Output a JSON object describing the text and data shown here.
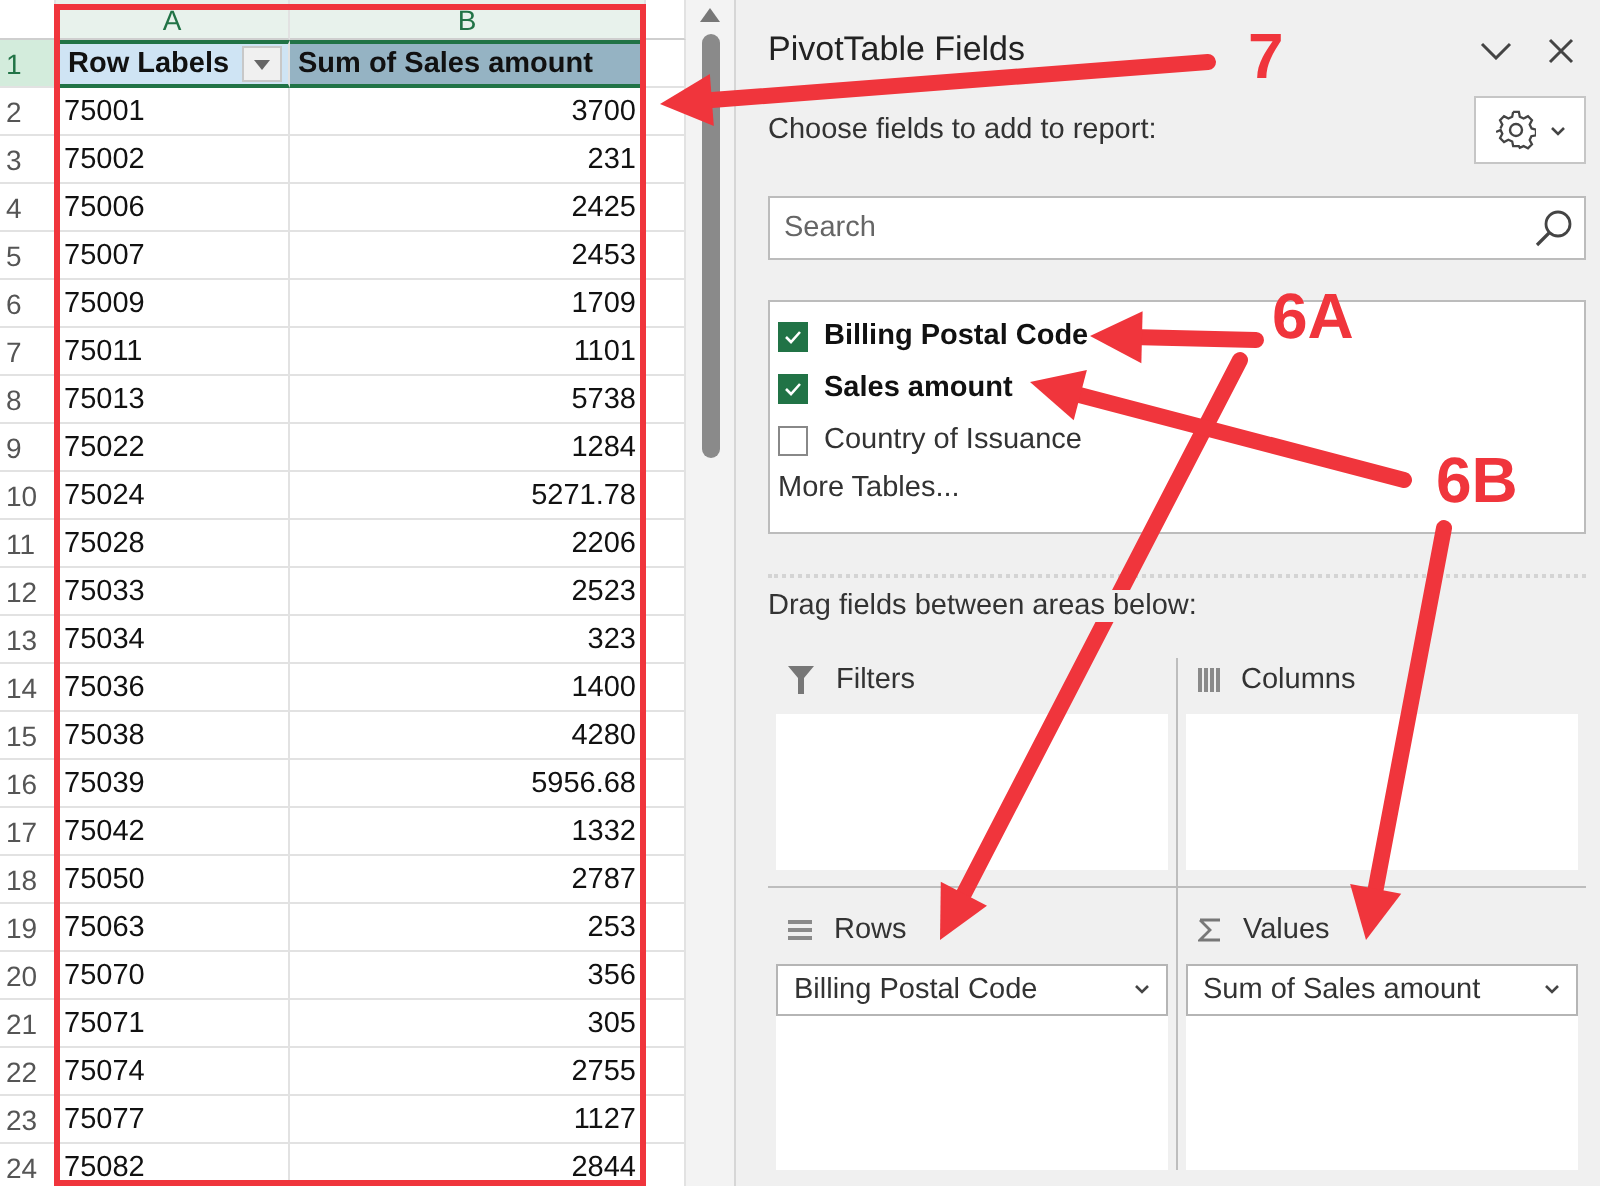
{
  "sheet": {
    "columns": [
      {
        "label": "A",
        "selected": true
      },
      {
        "label": "B",
        "selected": true
      }
    ],
    "header_row": {
      "number": "1",
      "selected": true,
      "row_labels": "Row Labels",
      "value_header": "Sum of Sales amount"
    },
    "rows": [
      {
        "number": "2",
        "label": "75001",
        "value": "3700"
      },
      {
        "number": "3",
        "label": "75002",
        "value": "231"
      },
      {
        "number": "4",
        "label": "75006",
        "value": "2425"
      },
      {
        "number": "5",
        "label": "75007",
        "value": "2453"
      },
      {
        "number": "6",
        "label": "75009",
        "value": "1709"
      },
      {
        "number": "7",
        "label": "75011",
        "value": "1101"
      },
      {
        "number": "8",
        "label": "75013",
        "value": "5738"
      },
      {
        "number": "9",
        "label": "75022",
        "value": "1284"
      },
      {
        "number": "10",
        "label": "75024",
        "value": "5271.78"
      },
      {
        "number": "11",
        "label": "75028",
        "value": "2206"
      },
      {
        "number": "12",
        "label": "75033",
        "value": "2523"
      },
      {
        "number": "13",
        "label": "75034",
        "value": "323"
      },
      {
        "number": "14",
        "label": "75036",
        "value": "1400"
      },
      {
        "number": "15",
        "label": "75038",
        "value": "4280"
      },
      {
        "number": "16",
        "label": "75039",
        "value": "5956.68"
      },
      {
        "number": "17",
        "label": "75042",
        "value": "1332"
      },
      {
        "number": "18",
        "label": "75050",
        "value": "2787"
      },
      {
        "number": "19",
        "label": "75063",
        "value": "253"
      },
      {
        "number": "20",
        "label": "75070",
        "value": "356"
      },
      {
        "number": "21",
        "label": "75071",
        "value": "305"
      },
      {
        "number": "22",
        "label": "75074",
        "value": "2755"
      },
      {
        "number": "23",
        "label": "75077",
        "value": "1127"
      },
      {
        "number": "24",
        "label": "75082",
        "value": "2844"
      }
    ]
  },
  "pivot_pane": {
    "title": "PivotTable Fields",
    "prompt": "Choose fields to add to report:",
    "search": {
      "placeholder": "Search"
    },
    "fields": [
      {
        "label": "Billing Postal Code",
        "checked": true
      },
      {
        "label": "Sales amount",
        "checked": true
      },
      {
        "label": "Country of Issuance",
        "checked": false
      }
    ],
    "more_tables": "More Tables...",
    "areas_hint": "Drag fields between areas below:",
    "areas": [
      {
        "kind": "filters",
        "title": "Filters"
      },
      {
        "kind": "columns",
        "title": "Columns"
      },
      {
        "kind": "rows",
        "title": "Rows",
        "items": [
          "Billing Postal Code"
        ]
      },
      {
        "kind": "values",
        "title": "Values",
        "items": [
          "Sum of Sales amount"
        ]
      }
    ]
  },
  "annotations": [
    {
      "label": "7"
    },
    {
      "label": "6A"
    },
    {
      "label": "6B"
    }
  ]
}
